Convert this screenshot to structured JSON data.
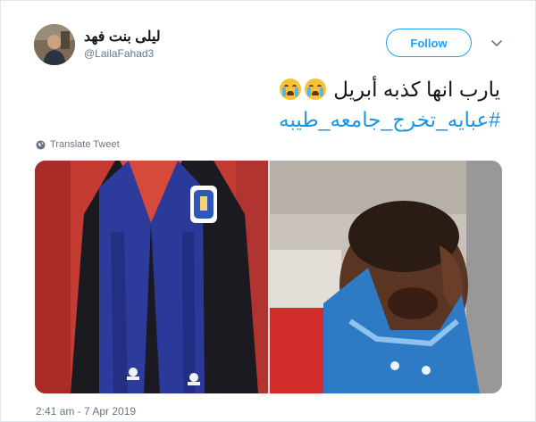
{
  "author": {
    "display_name": "ليلى بنت فهد",
    "handle": "@LailaFahad3"
  },
  "follow_button": {
    "label": "Follow"
  },
  "tweet": {
    "text_line1": "يارب انها كذبه أبريل",
    "emoji": [
      "loudly-crying-face",
      "loudly-crying-face"
    ],
    "hashtag": "#عبايه_تخرج_جامعه_طيبه"
  },
  "translate": {
    "label": "Translate Tweet"
  },
  "media": [
    {
      "name": "graduation-gown-photo",
      "kind": "photo"
    },
    {
      "name": "crying-baby-photo",
      "kind": "photo"
    }
  ],
  "timestamp": "2:41 am - 7 Apr 2019",
  "colors": {
    "accent": "#1da1f2",
    "hashtag": "#1b95e0",
    "secondary_text": "#657786"
  }
}
